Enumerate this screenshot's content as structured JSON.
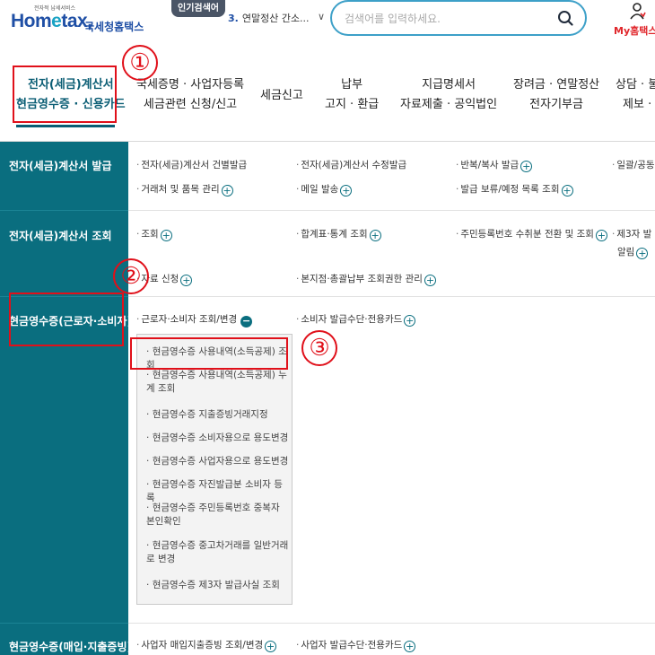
{
  "header": {
    "logo_subtitle": "전자적 납세서비스",
    "logo_home": "Hom",
    "logo_e": "e",
    "logo_tax": "tax,",
    "logo_korean": "국세청홈택스",
    "popular_tag": "인기검색어",
    "popular_number": "3.",
    "popular_text": "연말정산 간소...",
    "search_placeholder": "검색어를 입력하세요.",
    "my_hometax": "My홈택스"
  },
  "nav": {
    "items": [
      {
        "line1": "전자(세금)계산서",
        "line2": "현금영수증 · 신용카드"
      },
      {
        "line1": "국세증명 · 사업자등록",
        "line2": "세금관련 신청/신고"
      },
      {
        "line1": "세금신고",
        "line2": ""
      },
      {
        "line1": "납부",
        "line2": "고지 · 환급"
      },
      {
        "line1": "지급명세서",
        "line2": "자료제출 · 공익법인"
      },
      {
        "line1": "장려금 · 연말정산",
        "line2": "전자기부금"
      },
      {
        "line1": "상담 · 불",
        "line2": "제보 ·"
      }
    ]
  },
  "categories": {
    "cat1": "전자(세금)계산서 발급",
    "cat2": "전자(세금)계산서 조회",
    "cat3": "현금영수증(근로자·소비자)",
    "cat4": "현금영수증(매입·지출증빙)"
  },
  "links": {
    "r1_a": "전자(세금)계산서 건별발급",
    "r1_b": "전자(세금)계산서 수정발급",
    "r1_c": "반복/복사 발급",
    "r1_d": "일괄/공동",
    "r1_e": "거래처 및 품목 관리",
    "r1_f": "메일 발송",
    "r1_g": "발급 보류/예정 목록 조회",
    "r2_a": "조회",
    "r2_b": "합계표·통계 조회",
    "r2_c": "주민등록번호 수취분 전환 및 조회",
    "r2_d1": "제3자 발",
    "r2_d2": "알림",
    "r2_e": "자료 신청",
    "r2_f": "본지점·총괄납부 조회권한 관리",
    "r3_a": "근로자·소비자 조회/변경",
    "r3_b": "소비자 발급수단·전용카드",
    "r4_a": "사업자 매입지출증빙 조회/변경",
    "r4_b": "사업자 발급수단·전용카드"
  },
  "submenu": [
    "현금영수증 사용내역(소득공제) 조회",
    "현금영수증 사용내역(소득공제) 누계 조회",
    "현금영수증 지출증빙거래지정",
    "현금영수증 소비자용으로 용도변경",
    "현금영수증 사업자용으로 용도변경",
    "현금영수증 자진발급분 소비자 등록",
    "현금영수증 주민등록번호 중복자 본인확인",
    "현금영수증 중고차거래를 일반거래로 변경",
    "현금영수증 제3자 발급사실 조회"
  ],
  "annotations": [
    "①",
    "②",
    "③"
  ],
  "colors": {
    "teal": "#0a6e7f",
    "annotation_red": "#e0101a",
    "brand_blue": "#1f4fa5"
  }
}
